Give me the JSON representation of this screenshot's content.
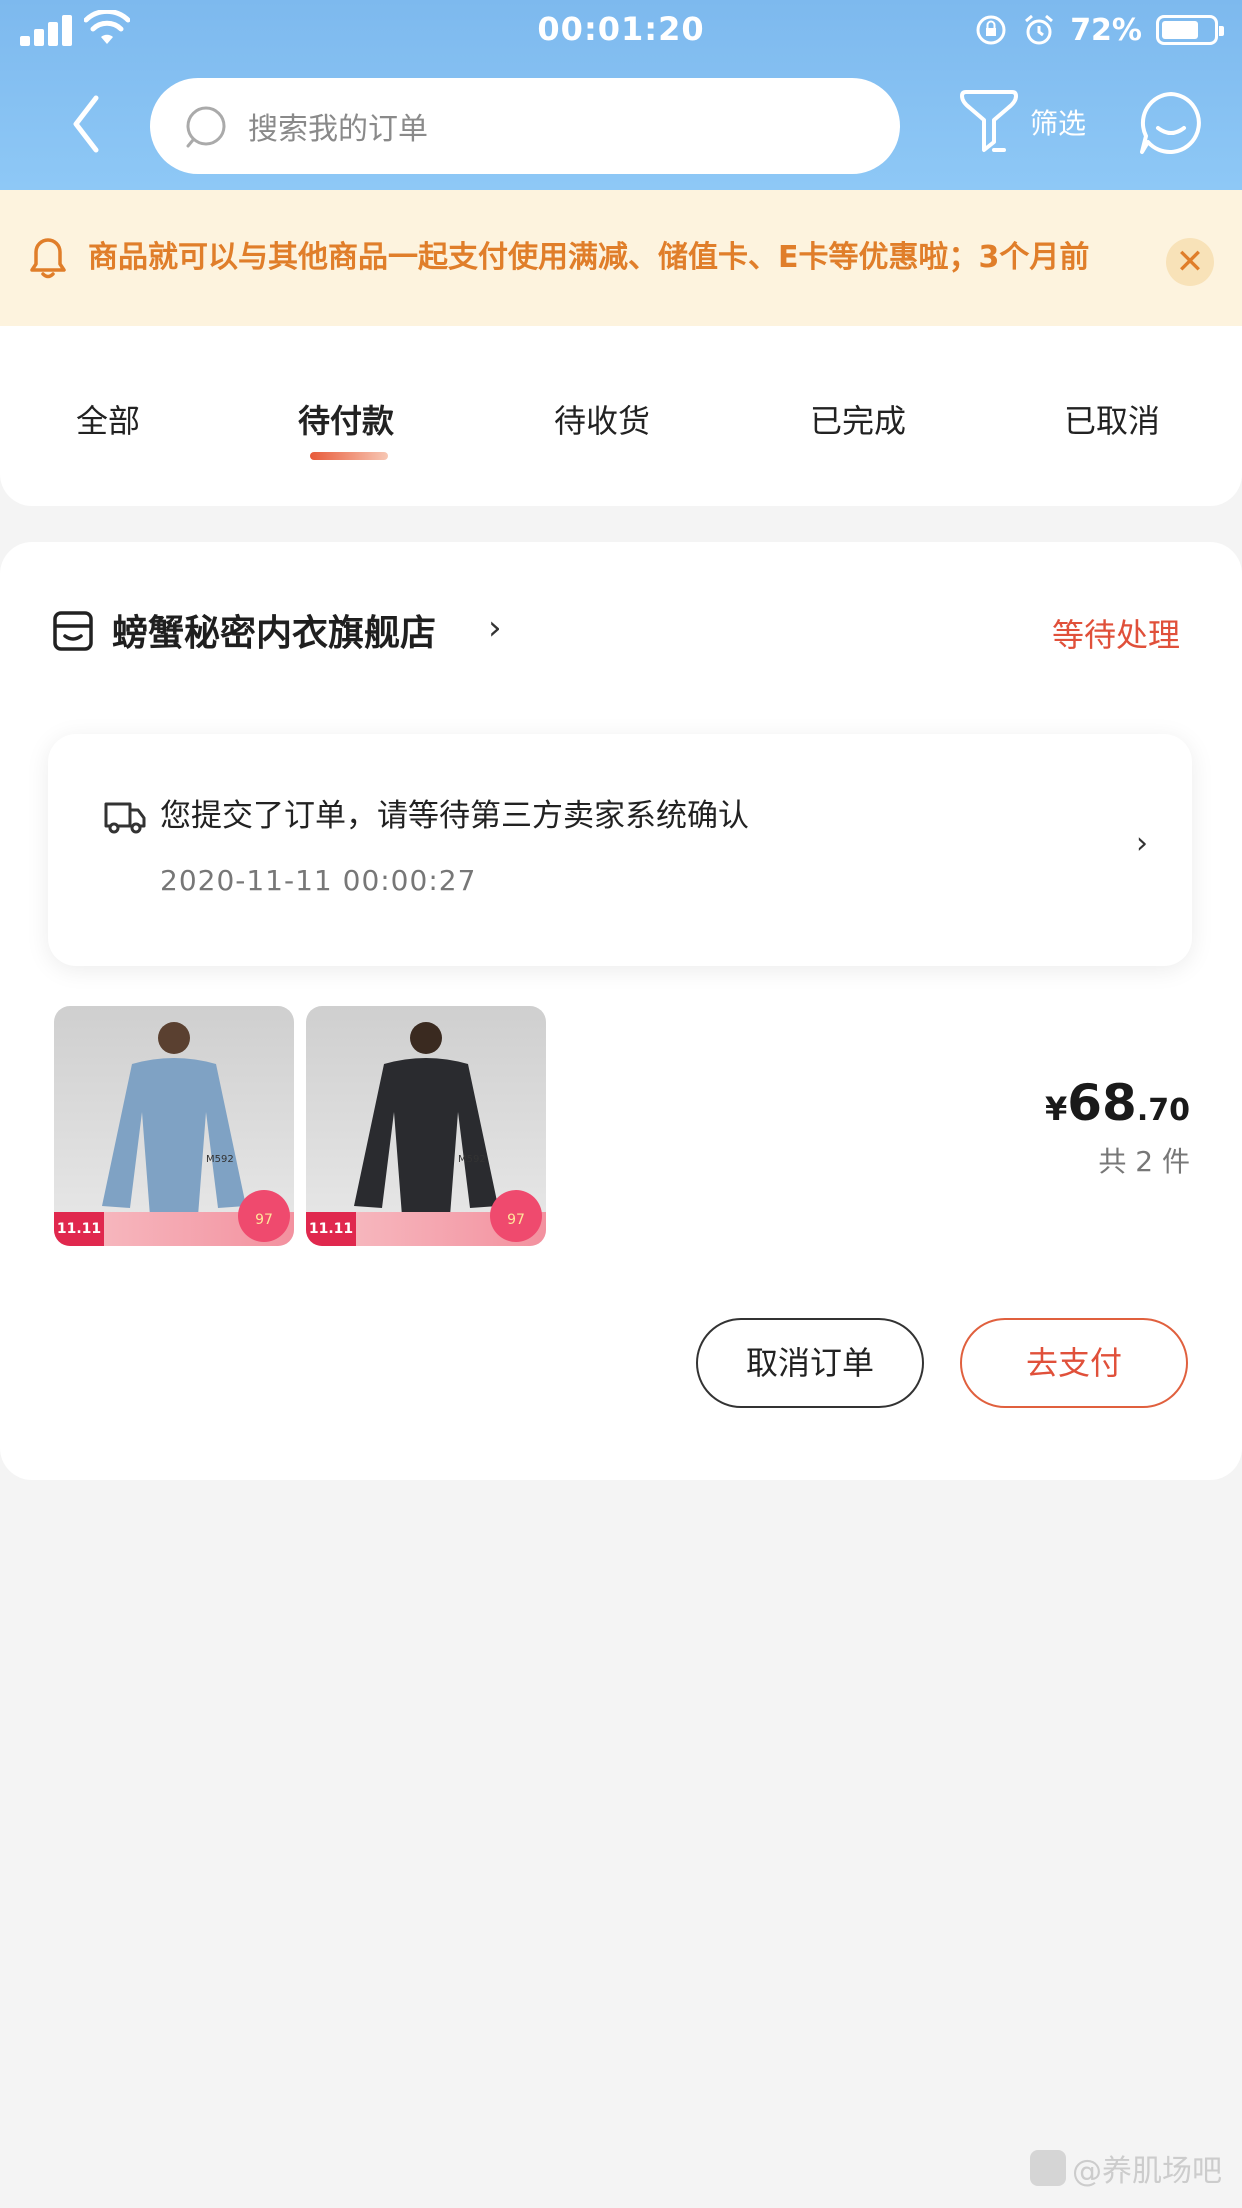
{
  "status_bar": {
    "time": "00:01:20",
    "battery_percent": "72%",
    "battery_level": 0.72
  },
  "header": {
    "search_placeholder": "搜索我的订单",
    "filter_label": "筛选"
  },
  "notice": {
    "text": "商品就可以与其他商品一起支付使用满减、储值卡、E卡等优惠啦；3个月前",
    "close_symbol": "✕"
  },
  "tabs": [
    {
      "label": "全部",
      "active": false
    },
    {
      "label": "待付款",
      "active": true
    },
    {
      "label": "待收货",
      "active": false
    },
    {
      "label": "已完成",
      "active": false
    },
    {
      "label": "已取消",
      "active": false
    }
  ],
  "order": {
    "store_name": "螃蟹秘密内衣旗舰店",
    "status": "等待处理",
    "tracking": {
      "message": "您提交了订单，请等待第三方卖家系统确认",
      "time": "2020-11-11 00:00:27"
    },
    "products": [
      {
        "color_hex": "#7fa2c4",
        "promo_tag": "11.11",
        "badge": "97"
      },
      {
        "color_hex": "#2a2b2f",
        "promo_tag": "11.11",
        "badge": "97"
      }
    ],
    "price": {
      "symbol": "¥",
      "integer": "68",
      "decimal": ".70"
    },
    "quantity_text": "共 2 件",
    "cancel_button": "取消订单",
    "pay_button": "去支付"
  },
  "watermark": "@养肌场吧",
  "colors": {
    "header_blue": "#8ec8f6",
    "accent_red": "#e0503a",
    "notice_orange": "#e07e2a",
    "notice_bg": "#fdf3de"
  }
}
